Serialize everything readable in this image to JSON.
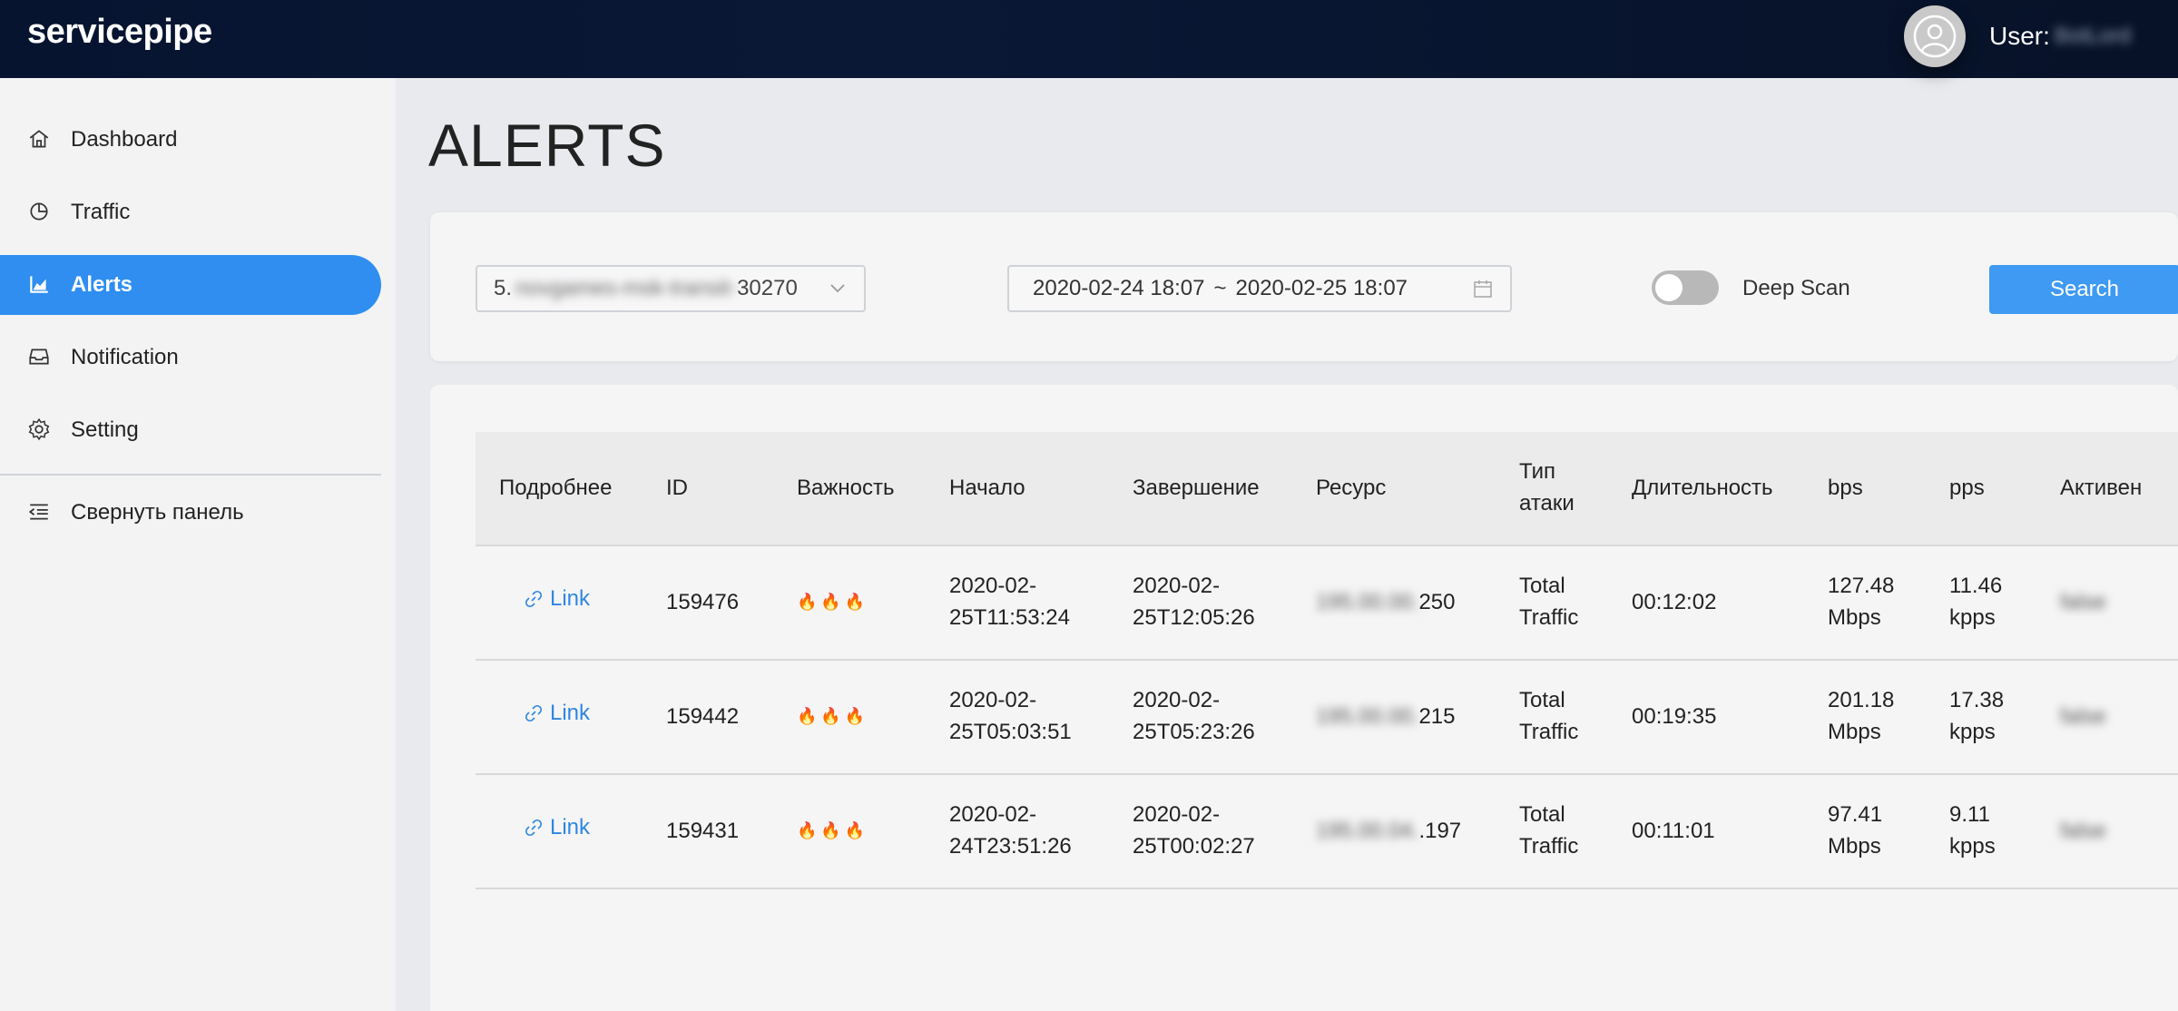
{
  "header": {
    "brand": "servicepipe",
    "user_label": "User:",
    "user_name": "BotLord"
  },
  "sidebar": {
    "items": [
      {
        "label": "Dashboard",
        "icon": "home-icon"
      },
      {
        "label": "Traffic",
        "icon": "pie-chart-icon"
      },
      {
        "label": "Alerts",
        "icon": "area-chart-icon",
        "active": true
      },
      {
        "label": "Notification",
        "icon": "inbox-icon"
      },
      {
        "label": "Setting",
        "icon": "gear-icon"
      }
    ],
    "collapse_label": "Свернуть панель"
  },
  "page": {
    "title": "ALERTS"
  },
  "filters": {
    "resource_prefix": "5.",
    "resource_blurred": "novgames-msk-transit-",
    "resource_suffix": "30270",
    "date_from": "2020-02-24 18:07",
    "date_sep": "~",
    "date_to": "2020-02-25 18:07",
    "deep_scan_label": "Deep Scan",
    "deep_scan_on": false,
    "search_label": "Search"
  },
  "table": {
    "columns": [
      "Подробнее",
      "ID",
      "Важность",
      "Начало",
      "Завершение",
      "Ресурс",
      "Тип атаки",
      "Длительность",
      "bps",
      "pps",
      "Активен"
    ],
    "rows": [
      {
        "link": "Link",
        "id": "159476",
        "severity": "🔥🔥🔥",
        "start_a": "2020-02-",
        "start_b": "25T11:53:24",
        "end_a": "2020-02-",
        "end_b": "25T12:05:26",
        "res_blur": "195.00.00.",
        "res_tail": "250",
        "type_a": "Total",
        "type_b": "Traffic",
        "duration": "00:12:02",
        "bps_a": "127.48",
        "bps_b": "Mbps",
        "pps_a": "11.46",
        "pps_b": "kpps",
        "active": "false"
      },
      {
        "link": "Link",
        "id": "159442",
        "severity": "🔥🔥🔥",
        "start_a": "2020-02-",
        "start_b": "25T05:03:51",
        "end_a": "2020-02-",
        "end_b": "25T05:23:26",
        "res_blur": "195.00.00.",
        "res_tail": "215",
        "type_a": "Total",
        "type_b": "Traffic",
        "duration": "00:19:35",
        "bps_a": "201.18",
        "bps_b": "Mbps",
        "pps_a": "17.38",
        "pps_b": "kpps",
        "active": "false"
      },
      {
        "link": "Link",
        "id": "159431",
        "severity": "🔥🔥🔥",
        "start_a": "2020-02-",
        "start_b": "24T23:51:26",
        "end_a": "2020-02-",
        "end_b": "25T00:02:27",
        "res_blur": "195.00.04.",
        "res_tail": ".197",
        "type_a": "Total",
        "type_b": "Traffic",
        "duration": "00:11:01",
        "bps_a": "97.41",
        "bps_b": "Mbps",
        "pps_a": "9.11",
        "pps_b": "kpps",
        "active": "false"
      }
    ]
  },
  "colors": {
    "accent": "#2f8ef0",
    "header_bg": "#061430",
    "link": "#2f86e0"
  }
}
